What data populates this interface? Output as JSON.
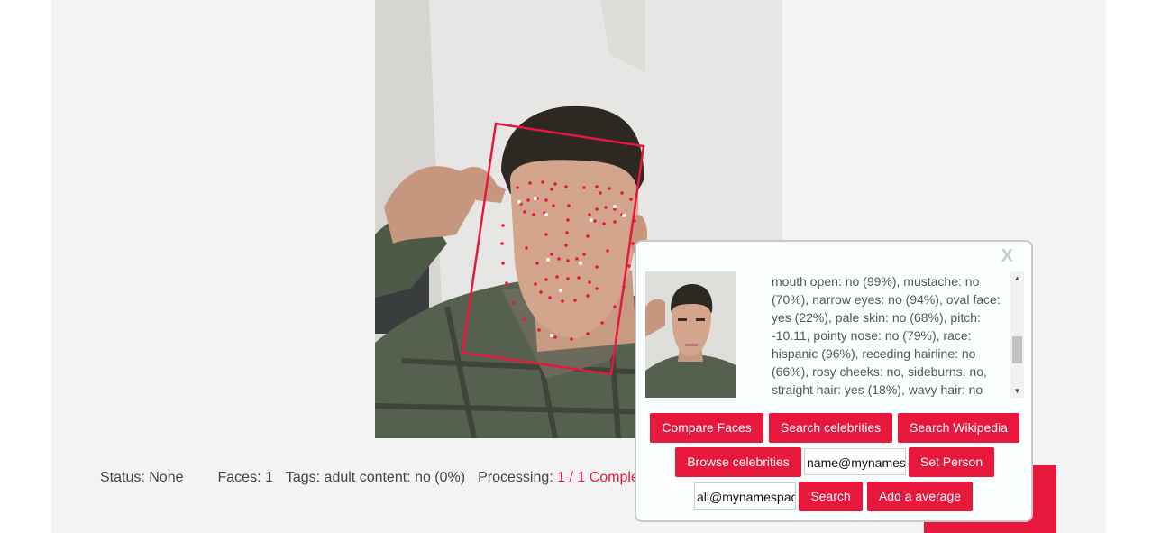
{
  "status_bar": {
    "status": "Status: None",
    "faces": "Faces: 1",
    "tags": "Tags: adult content: no (0%)",
    "processing_label": "Processing:",
    "processing_value": "1 / 1 Comple"
  },
  "popup": {
    "close_label": "X",
    "description": "mouth open: no (99%), mustache: no (70%), narrow eyes: no (94%), oval face: yes (22%), pale skin: no (68%), pitch: -10.11, pointy nose: no (79%), race: hispanic (96%), receding hairline: no (66%), rosy cheeks: no, sideburns: no, straight hair: yes (18%), wavy hair: no",
    "buttons": {
      "compare_faces": "Compare Faces",
      "search_celebrities": "Search celebrities",
      "search_wikipedia": "Search Wikipedia",
      "browse_celebrities": "Browse celebrities",
      "set_person": "Set Person",
      "search": "Search",
      "add_average": "Add a average"
    },
    "name_input_value": "name@mynamespace",
    "all_input_value": "all@mynamespace"
  },
  "colors": {
    "accent": "#e8173c",
    "panel_bg": "#f3f3f3",
    "popup_border": "#c8c8c8"
  }
}
